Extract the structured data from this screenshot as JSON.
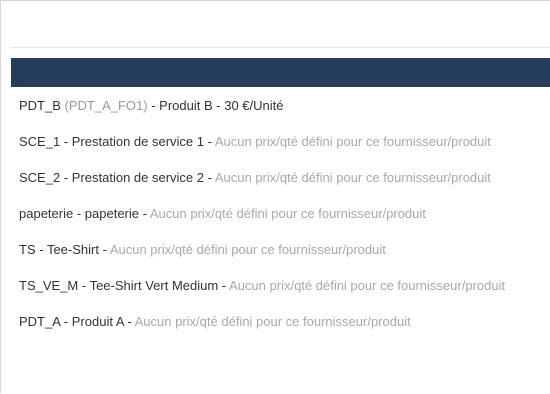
{
  "search": {
    "value": "",
    "placeholder": ""
  },
  "colors": {
    "header": "#263c5d",
    "text": "#333333",
    "muted": "#a8a8a8"
  },
  "options": [
    {
      "ref": "PDT_B",
      "alt": "(PDT_A_FO1)",
      "name": "Produit B",
      "price": "30 €/Unité",
      "note": ""
    },
    {
      "ref": "SCE_1",
      "alt": "",
      "name": "Prestation de service 1",
      "price": "",
      "note": "Aucun prix/qté défini pour ce fournisseur/produit"
    },
    {
      "ref": "SCE_2",
      "alt": "",
      "name": "Prestation de service 2",
      "price": "",
      "note": "Aucun prix/qté défini pour ce fournisseur/produit"
    },
    {
      "ref": "papeterie",
      "alt": "",
      "name": "papeterie",
      "price": "",
      "note": "Aucun prix/qté défini pour ce fournisseur/produit"
    },
    {
      "ref": "TS",
      "alt": "",
      "name": "Tee-Shirt",
      "price": "",
      "note": "Aucun prix/qté défini pour ce fournisseur/produit"
    },
    {
      "ref": "TS_VE_M",
      "alt": "",
      "name": "Tee-Shirt Vert Medium",
      "price": "",
      "note": "Aucun prix/qté défini pour ce fournisseur/produit"
    },
    {
      "ref": "PDT_A",
      "alt": "",
      "name": "Produit A",
      "price": "",
      "note": "Aucun prix/qté défini pour ce fournisseur/produit"
    }
  ]
}
